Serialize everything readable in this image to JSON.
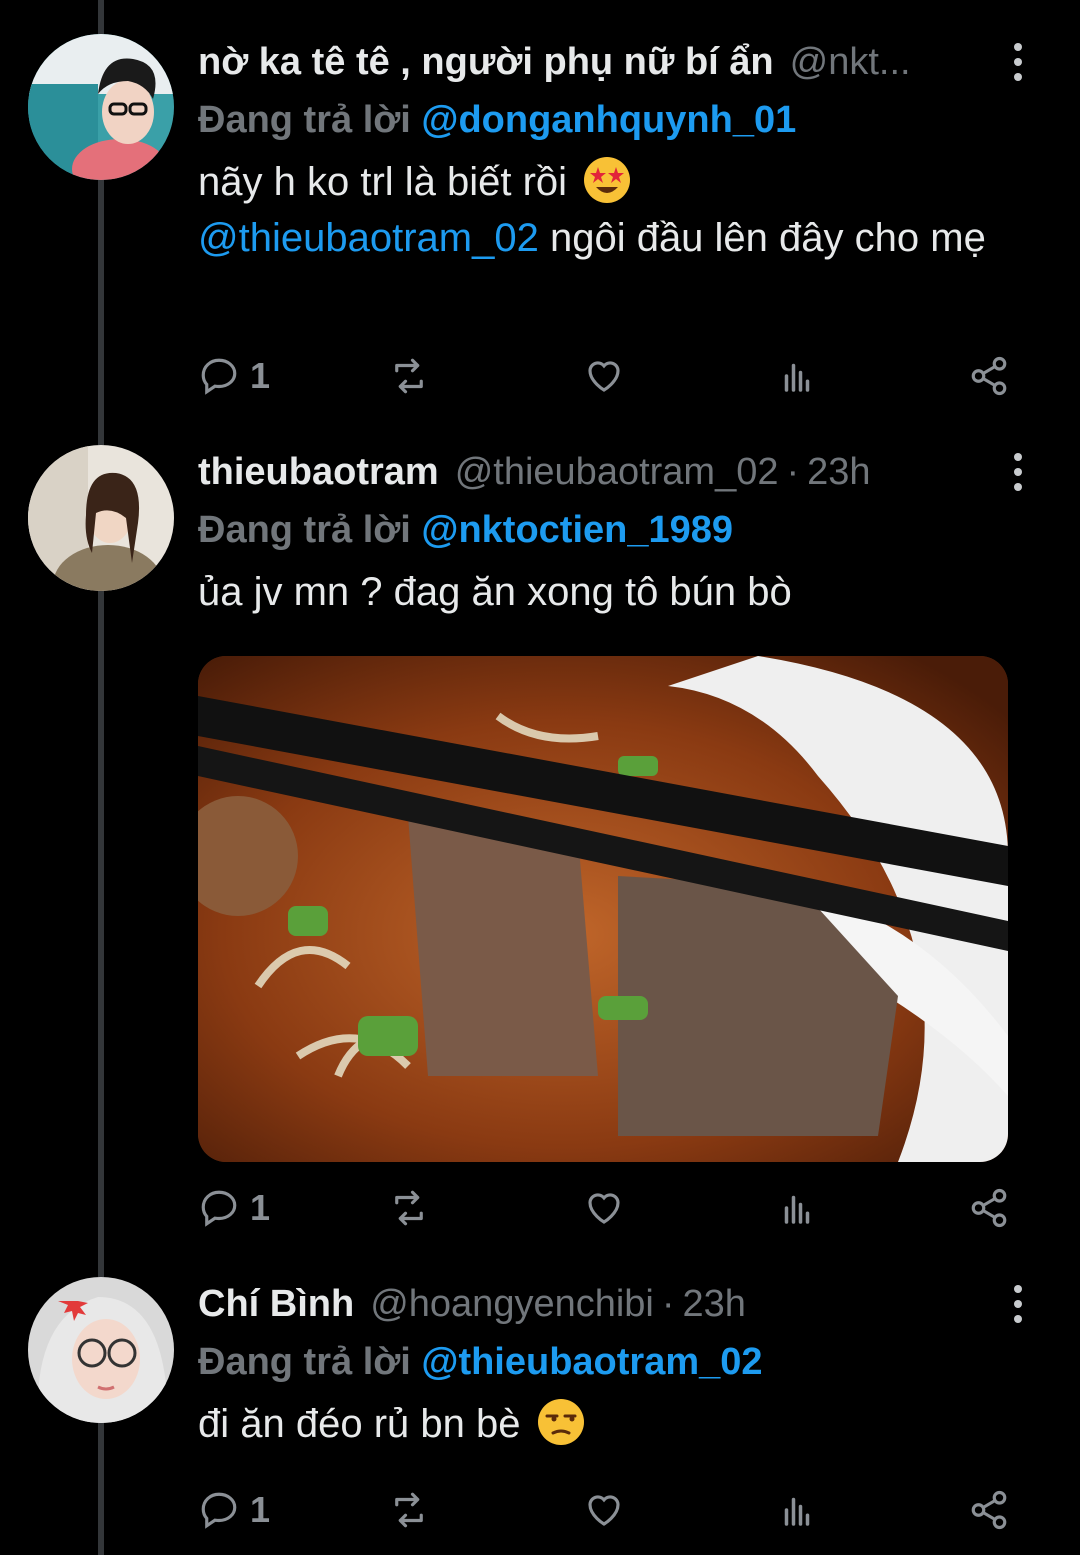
{
  "app": {
    "name": "Twitter",
    "accent_color": "#1d9bf0",
    "muted_color": "#71767b"
  },
  "tweets": [
    {
      "display_name": "nờ ka tê tê , người phụ nữ bí ẩn",
      "handle": "@nkt...",
      "time": "",
      "replying_prefix": "Đang trả lời",
      "replying_to": "@donganhquynh_01",
      "text_lines": [
        "nãy h ko trl là biết rồi",
        "ngôi đầu lên đây cho mẹ"
      ],
      "text_mention": "@thieubaotram_02",
      "emoji": "star-struck-emoji",
      "avatar": "avatar-woman-curly-hair",
      "reply_count": "1",
      "retweet_count": "",
      "like_count": ""
    },
    {
      "display_name": "thieubaotram",
      "handle": "@thieubaotram_02",
      "time": "23h",
      "separator": "·",
      "replying_prefix": "Đang trả lời",
      "replying_to": "@nktoctien_1989",
      "text": "ủa jv mn ? đag ăn xong tô bún bò",
      "media": "photo-bun-bo-bowl-with-chopsticks",
      "avatar": "avatar-woman-long-hair",
      "reply_count": "1",
      "retweet_count": "",
      "like_count": ""
    },
    {
      "display_name": "Chí Bình",
      "handle": "@hoangyenchibi",
      "time": "23h",
      "separator": "·",
      "replying_prefix": "Đang trả lời",
      "replying_to": "@thieubaotram_02",
      "text": "đi ăn đéo rủ bn bè",
      "emoji": "unamused-face-emoji",
      "avatar": "avatar-woman-glasses",
      "reply_count": "1",
      "retweet_count": "",
      "like_count": ""
    }
  ],
  "icons": {
    "reply": "reply-icon",
    "retweet": "retweet-icon",
    "like": "heart-icon",
    "views": "analytics-icon",
    "share": "share-icon",
    "more": "more-vertical-icon"
  }
}
